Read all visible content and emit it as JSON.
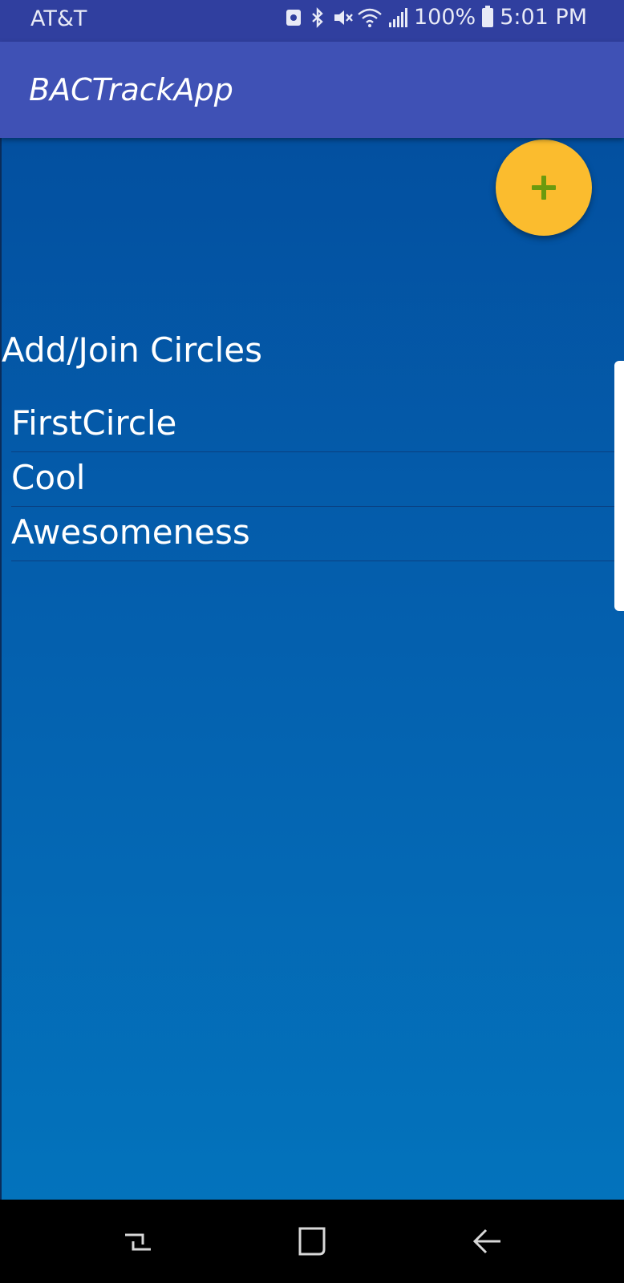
{
  "status_bar": {
    "carrier": "AT&T",
    "battery": "100%",
    "time": "5:01 PM",
    "icons": [
      "notification-icon",
      "bluetooth-icon",
      "mute-icon",
      "wifi-icon",
      "signal-icon",
      "battery-icon"
    ]
  },
  "app_bar": {
    "title": "BACTrackApp",
    "color": "#3F51B5"
  },
  "fab": {
    "icon": "plus-icon",
    "color": "#FBBC2E",
    "icon_color": "#6B9A0E"
  },
  "main": {
    "heading": "Add/Join Circles",
    "circles": [
      {
        "label": "FirstCircle"
      },
      {
        "label": "Cool"
      },
      {
        "label": "Awesomeness"
      }
    ]
  },
  "nav_bar": {
    "buttons": [
      "recent-apps-icon",
      "home-icon",
      "back-icon"
    ]
  }
}
